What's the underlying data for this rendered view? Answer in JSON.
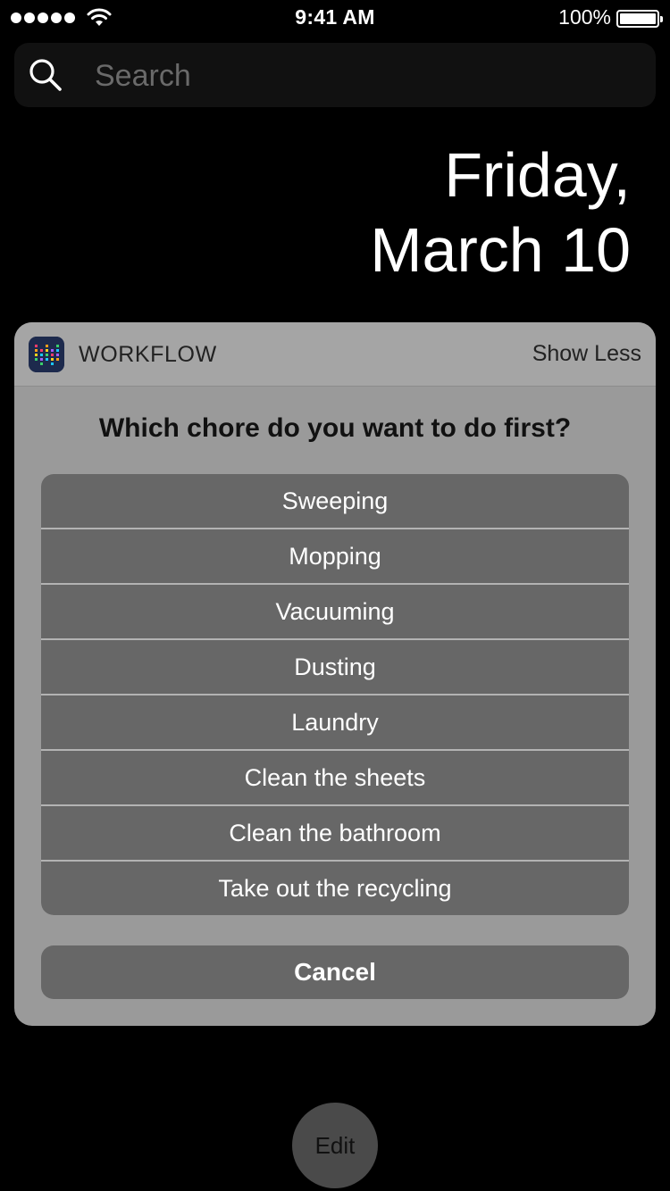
{
  "status_bar": {
    "time": "9:41 AM",
    "battery_percent": "100%",
    "signal_bars": 5,
    "icons": [
      "cell-signal-icon",
      "wifi-icon",
      "battery-icon"
    ]
  },
  "search": {
    "placeholder": "Search",
    "icon": "search-icon"
  },
  "date": {
    "line1": "Friday,",
    "line2": "March 10"
  },
  "widget": {
    "app_name": "WORKFLOW",
    "app_icon": "workflow-app-icon",
    "show_less_label": "Show Less",
    "question": "Which chore do you want to do first?",
    "options": [
      {
        "label": "Sweeping"
      },
      {
        "label": "Mopping"
      },
      {
        "label": "Vacuuming"
      },
      {
        "label": "Dusting"
      },
      {
        "label": "Laundry"
      },
      {
        "label": "Clean the sheets"
      },
      {
        "label": "Clean the bathroom"
      },
      {
        "label": "Take out the recycling"
      }
    ],
    "cancel_label": "Cancel"
  },
  "edit_label": "Edit",
  "colors": {
    "background": "#000000",
    "widget_bg": "#9a9a9a",
    "button_bg": "#676767"
  }
}
